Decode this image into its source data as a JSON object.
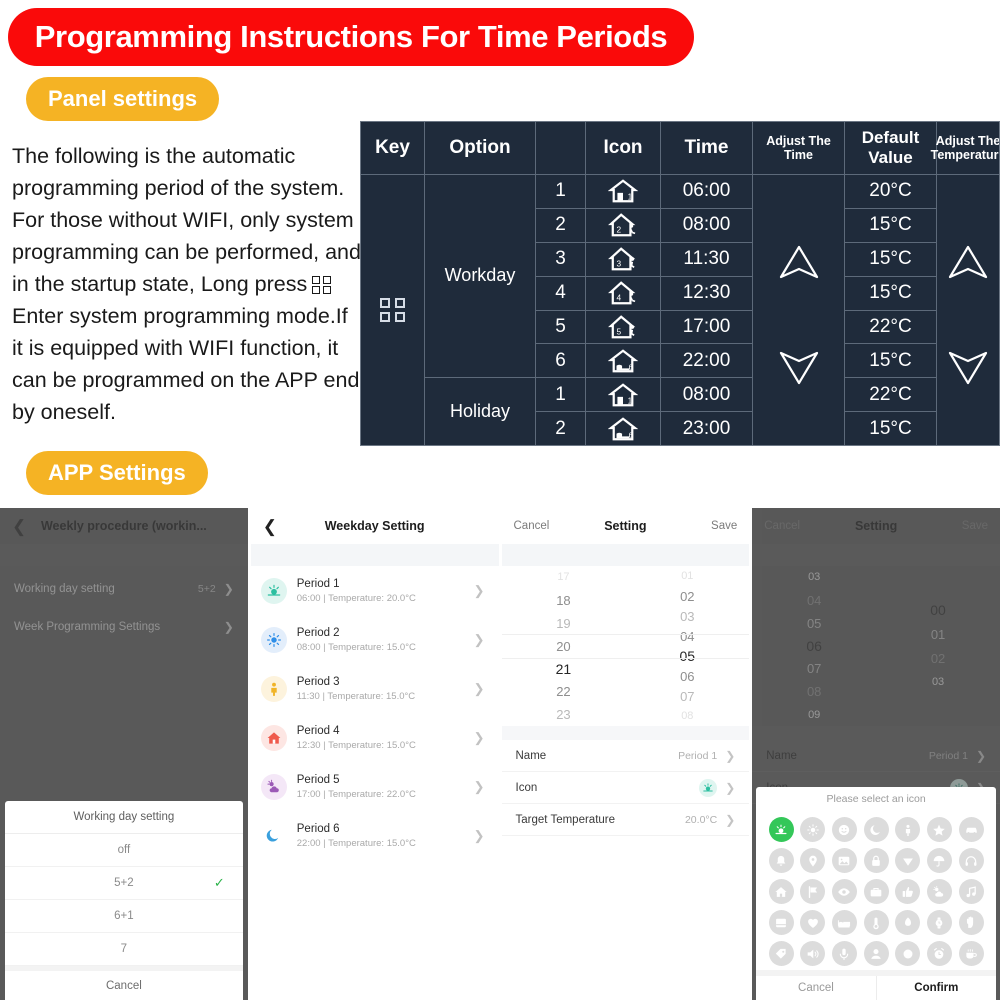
{
  "header": {
    "title": "Programming Instructions For Time Periods",
    "title_bg": "#fa0a0a",
    "pill_bg": "#f5b324"
  },
  "sections": {
    "panel_settings_label": "Panel settings",
    "app_settings_label": "APP Settings"
  },
  "intro": {
    "part1": "The following is the automatic programming period of the system. For those without WIFI, only system programming can be performed, and in the startup state, Long press",
    "part2": "Enter system programming mode.If it is equipped with WIFI function, it can be programmed on the APP end by oneself.",
    "key_icon": "grid-2x2-icon"
  },
  "table": {
    "headers": {
      "key": "Key",
      "option": "Option",
      "icon": "Icon",
      "time": "Time",
      "adjust_the_time": "Adjust The Time",
      "default_value": "Default Value",
      "adjust_the_temperature": "Adjust The Temperature"
    },
    "key_icon": "grid-2x2-icon",
    "groups": [
      {
        "name": "Workday",
        "rows": [
          {
            "num": "1",
            "icon": "house-1-icon",
            "time": "06:00",
            "temp": "20°C"
          },
          {
            "num": "2",
            "icon": "house-2-leave-icon",
            "time": "08:00",
            "temp": "15°C"
          },
          {
            "num": "3",
            "icon": "house-3-return-icon",
            "time": "11:30",
            "temp": "15°C"
          },
          {
            "num": "4",
            "icon": "house-4-leave-icon",
            "time": "12:30",
            "temp": "15°C"
          },
          {
            "num": "5",
            "icon": "house-5-return-icon",
            "time": "17:00",
            "temp": "22°C"
          },
          {
            "num": "6",
            "icon": "house-6-sleep-icon",
            "time": "22:00",
            "temp": "15°C"
          }
        ]
      },
      {
        "name": "Holiday",
        "rows": [
          {
            "num": "1",
            "icon": "house-1-icon",
            "time": "08:00",
            "temp": "22°C"
          },
          {
            "num": "2",
            "icon": "house-6-sleep-icon",
            "time": "23:00",
            "temp": "15°C"
          }
        ]
      }
    ],
    "arrow_up": "chevron-up-arrow-icon",
    "arrow_down": "chevron-down-arrow-icon"
  },
  "panel1": {
    "back_icon": "back-chevron-icon",
    "title": "Weekly procedure (workin...",
    "rows": [
      {
        "label": "Working day setting",
        "value": "5+2"
      },
      {
        "label": "Week Programming Settings",
        "value": ""
      }
    ],
    "sheet": {
      "title": "Working day setting",
      "options": [
        {
          "label": "off",
          "selected": false
        },
        {
          "label": "5+2",
          "selected": true
        },
        {
          "label": "6+1",
          "selected": false
        },
        {
          "label": "7",
          "selected": false
        }
      ],
      "cancel": "Cancel",
      "check_color": "#2cb34a"
    }
  },
  "panel2": {
    "back_icon": "back-chevron-icon",
    "title": "Weekday Setting",
    "periods": [
      {
        "name": "Period 1",
        "sub": "06:00  |  Temperature: 20.0°C",
        "icon": "sunrise-icon",
        "color": "#2bbfa0",
        "bg": "#dff5f0"
      },
      {
        "name": "Period 2",
        "sub": "08:00  |  Temperature: 15.0°C",
        "icon": "sun-icon",
        "color": "#2f8fe8",
        "bg": "#e3eefb"
      },
      {
        "name": "Period 3",
        "sub": "11:30  |  Temperature: 15.0°C",
        "icon": "person-icon",
        "color": "#f0b429",
        "bg": "#fdf3dd"
      },
      {
        "name": "Period 4",
        "sub": "12:30  |  Temperature: 15.0°C",
        "icon": "house-icon",
        "color": "#ef5a4c",
        "bg": "#fde6e3"
      },
      {
        "name": "Period 5",
        "sub": "17:00  |  Temperature: 22.0°C",
        "icon": "sun-cloud-icon",
        "color": "#9b59b6",
        "bg": "#f4e7f7"
      },
      {
        "name": "Period 6",
        "sub": "22:00  |  Temperature: 15.0°C",
        "icon": "moon-icon",
        "color": "#3aa0dd",
        "bg": "#ffffff"
      }
    ]
  },
  "panel3": {
    "cancel": "Cancel",
    "title": "Setting",
    "save": "Save",
    "hours": [
      "17",
      "18",
      "19",
      "20",
      "21",
      "22",
      "23"
    ],
    "hours_selected": "21",
    "minutes": [
      "01",
      "02",
      "03",
      "04",
      "05",
      "06",
      "07",
      "08"
    ],
    "minutes_selected": "05",
    "form": [
      {
        "label": "Name",
        "value": "Period 1",
        "type": "text"
      },
      {
        "label": "Icon",
        "value": "",
        "type": "icon",
        "icon": "sunrise-icon"
      },
      {
        "label": "Target Temperature",
        "value": "20.0°C",
        "type": "text"
      }
    ]
  },
  "panel4": {
    "cancel": "Cancel",
    "title": "Setting",
    "save": "Save",
    "hours": [
      "03",
      "04",
      "05",
      "06",
      "07",
      "08",
      "09"
    ],
    "hours_selected": "06",
    "minutes": [
      "00",
      "01",
      "02",
      "03"
    ],
    "minutes_selected": "00",
    "form": [
      {
        "label": "Name",
        "value": "Period 1",
        "type": "text"
      },
      {
        "label": "Icon",
        "value": "",
        "type": "icon",
        "icon": "sunrise-icon"
      }
    ],
    "icon_sheet": {
      "title": "Please select an icon",
      "cancel": "Cancel",
      "confirm": "Confirm",
      "active_index": 0,
      "active_color": "#34c759",
      "icons": [
        "sunrise-icon",
        "sun-icon",
        "smiley-icon",
        "moon-icon",
        "person-icon",
        "star-icon",
        "car-icon",
        "bell-icon",
        "location-pin-icon",
        "image-icon",
        "lock-icon",
        "diamond-icon",
        "umbrella-icon",
        "headphones-icon",
        "house-icon",
        "flag-icon",
        "eye-icon",
        "briefcase-icon",
        "thumbs-up-icon",
        "sun-cloud-icon",
        "music-note-icon",
        "book-icon",
        "heart-icon",
        "bed-icon",
        "thermometer-icon",
        "flame-icon",
        "watch-icon",
        "hand-icon",
        "tag-icon",
        "speaker-icon",
        "microphone-icon",
        "pin-icon",
        "circle-icon",
        "alarm-clock-icon",
        "coffee-cup-icon"
      ]
    }
  }
}
